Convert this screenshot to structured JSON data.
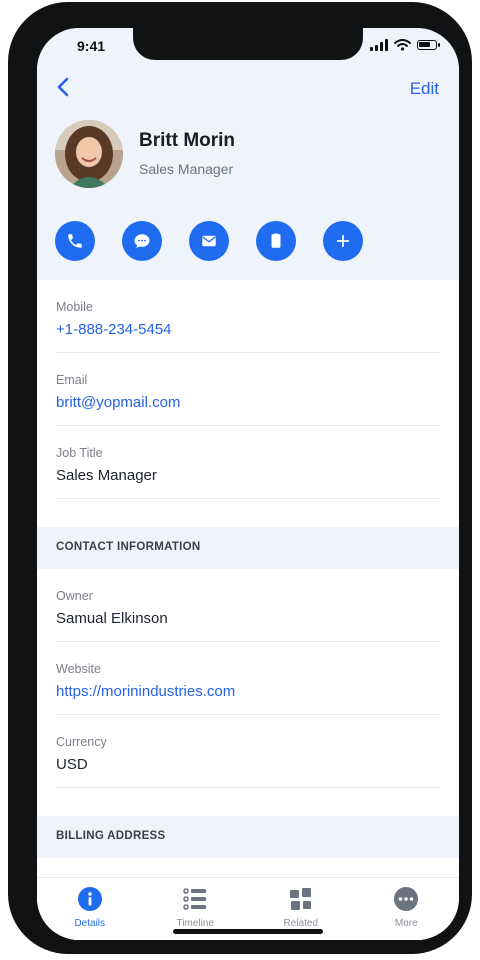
{
  "status_bar": {
    "time": "9:41"
  },
  "header": {
    "back_icon": "chevron-left-icon",
    "edit_label": "Edit"
  },
  "contact": {
    "name": "Britt Morin",
    "title": "Sales Manager"
  },
  "actions": [
    {
      "name": "call",
      "icon": "phone-icon"
    },
    {
      "name": "message",
      "icon": "chat-bubble-icon"
    },
    {
      "name": "email",
      "icon": "mail-icon"
    },
    {
      "name": "note",
      "icon": "document-icon"
    },
    {
      "name": "add",
      "icon": "plus-icon"
    }
  ],
  "fields": [
    {
      "label": "Mobile",
      "value": "+1-888-234-5454"
    },
    {
      "label": "Email",
      "value": "britt@yopmail.com"
    },
    {
      "label": "Job Title",
      "value": "Sales Manager"
    }
  ],
  "section_contact": {
    "title": "CONTACT INFORMATION",
    "fields": [
      {
        "label": "Owner",
        "value": "Samual Elkinson"
      },
      {
        "label": "Website",
        "value": "https://morinindustries.com"
      },
      {
        "label": "Currency",
        "value": "USD"
      }
    ]
  },
  "section_billing": {
    "title": "BILLING ADDRESS"
  },
  "tabs": [
    {
      "label": "Details",
      "icon": "info-icon",
      "active": true
    },
    {
      "label": "Timeline",
      "icon": "list-icon",
      "active": false
    },
    {
      "label": "Related",
      "icon": "grid-icon",
      "active": false
    },
    {
      "label": "More",
      "icon": "more-icon",
      "active": false
    }
  ],
  "colors": {
    "accent": "#1f6cf0",
    "link": "#2462e6",
    "header_bg": "#eff3fb"
  }
}
